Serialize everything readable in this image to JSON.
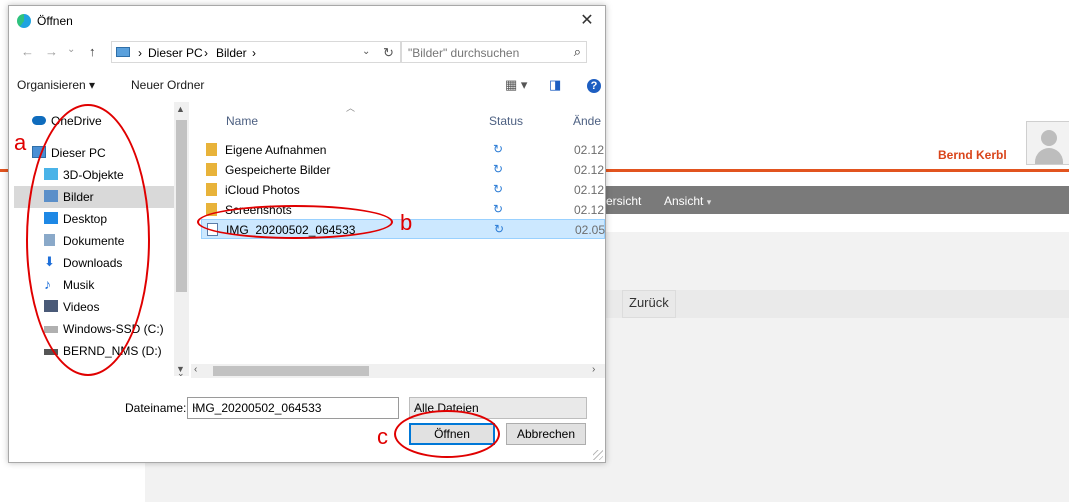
{
  "background_app": {
    "user_name": "Bernd Kerbl",
    "nav_fragment": "ersicht",
    "nav_ansicht": "Ansicht",
    "btn_fragment": "n",
    "zurueck_label": "Zurück"
  },
  "dialog": {
    "title": "Öffnen",
    "close_glyph": "✕",
    "nav": {
      "back": "←",
      "forward": "→",
      "recent": "⌄",
      "up": "↑"
    },
    "breadcrumb": {
      "sep1": "›",
      "pc": "Dieser PC",
      "sep2": "›",
      "folder": "Bilder",
      "sep3": "›"
    },
    "address_dropdown": "⌄",
    "refresh_glyph": "↻",
    "search_placeholder": "\"Bilder\" durchsuchen",
    "search_glyph": "⌕",
    "toolbar": {
      "organize": "Organisieren ▾",
      "new_folder": "Neuer Ordner",
      "view_glyph": "▦ ▾",
      "pane_glyph": "◨",
      "help_glyph": "?"
    },
    "nav_pane": {
      "items": [
        {
          "label": "OneDrive",
          "icon": "cloud-icon",
          "color": "#0f6cbd"
        },
        {
          "label": "Dieser PC",
          "icon": "computer-icon",
          "color": "#4a8fd4"
        },
        {
          "label": "3D-Objekte",
          "icon": "cube-icon",
          "color": "#4ab3e8"
        },
        {
          "label": "Bilder",
          "icon": "pictures-icon",
          "color": "#5b8fc9",
          "selected": true
        },
        {
          "label": "Desktop",
          "icon": "desktop-icon",
          "color": "#1e88e5"
        },
        {
          "label": "Dokumente",
          "icon": "document-icon",
          "color": "#8aa9c9"
        },
        {
          "label": "Downloads",
          "icon": "download-icon",
          "color": "#1e6fd9"
        },
        {
          "label": "Musik",
          "icon": "music-icon",
          "color": "#1e6fd9"
        },
        {
          "label": "Videos",
          "icon": "video-icon",
          "color": "#4a5a78"
        },
        {
          "label": "Windows-SSD (C:)",
          "icon": "drive-icon",
          "color": "#8a8a8a"
        },
        {
          "label": "BERND_NMS (D:)",
          "icon": "drive-icon",
          "color": "#555555"
        }
      ]
    },
    "columns": {
      "name": "Name",
      "status": "Status",
      "date": "Ände"
    },
    "files": [
      {
        "name": "Eigene Aufnahmen",
        "type": "folder",
        "status": "↻",
        "date": "02.12"
      },
      {
        "name": "Gespeicherte Bilder",
        "type": "folder",
        "status": "↻",
        "date": "02.12"
      },
      {
        "name": "iCloud Photos",
        "type": "folder",
        "status": "↻",
        "date": "02.12"
      },
      {
        "name": "Screenshots",
        "type": "folder",
        "status": "↻",
        "date": "02.12"
      },
      {
        "name": "IMG_20200502_064533",
        "type": "image",
        "status": "↻",
        "date": "02.05",
        "selected": true
      }
    ],
    "filename_label": "Dateiname:",
    "filename_value": "IMG_20200502_064533",
    "filter_value": "Alle Dateien",
    "open_label": "Öffnen",
    "cancel_label": "Abbrechen"
  },
  "annotations": {
    "a": "a",
    "b": "b",
    "c": "c",
    "color": "#e00000"
  },
  "colors": {
    "accent": "#0078d7",
    "selection": "#cce8ff",
    "brand_orange": "#e2541f"
  }
}
